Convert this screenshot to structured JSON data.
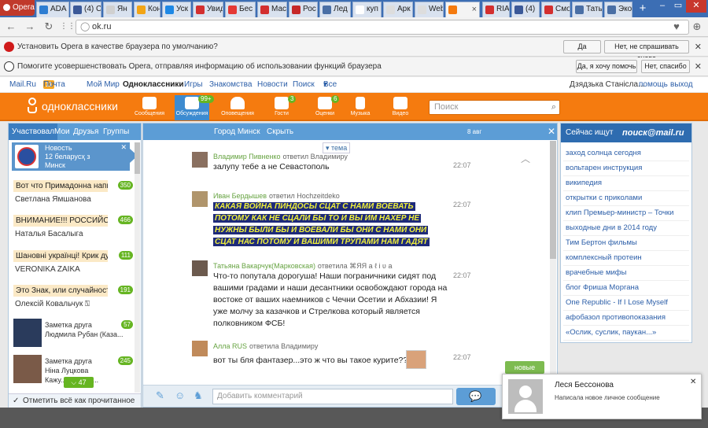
{
  "browser": {
    "opera_label": "Opera",
    "tabs": [
      {
        "label": "ADA",
        "color": "#2d7dd2"
      },
      {
        "label": "(4) С",
        "color": "#3b5998"
      },
      {
        "label": "Ян",
        "color": "#d0d0d0"
      },
      {
        "label": "Кон",
        "color": "#f2a516"
      },
      {
        "label": "Уск",
        "color": "#1e88e5"
      },
      {
        "label": "Увид",
        "color": "#d32f2f"
      },
      {
        "label": "Бес",
        "color": "#e53935"
      },
      {
        "label": "Мас",
        "color": "#d32f2f"
      },
      {
        "label": "Рос",
        "color": "#c62828"
      },
      {
        "label": "Лед",
        "color": "#4a6fa5"
      },
      {
        "label": "куп",
        "color": "#fff"
      },
      {
        "label": "Арк",
        "color": "#ddd"
      },
      {
        "label": "Web",
        "color": "#ddd"
      },
      {
        "label": "",
        "color": "#f57b0f"
      },
      {
        "label": "RIA",
        "color": "#d32f2f"
      },
      {
        "label": "(4) ",
        "color": "#3b5998"
      },
      {
        "label": "Смо",
        "color": "#d32f2f"
      },
      {
        "label": "Татья",
        "color": "#4a6fa5"
      },
      {
        "label": "Эко",
        "color": "#4a6fa5"
      }
    ],
    "url": "ok.ru"
  },
  "infobars": [
    {
      "text": "Установить Opera в качестве браузера по умолчанию?",
      "btn1": "Да",
      "btn2": "Нет, не спрашивать снова"
    },
    {
      "text": "Помогите усовершенствовать Opera, отправляя информацию об использовании функций браузера",
      "btn1": "Да, я хочу помочь",
      "btn2": "Нет, спасибо"
    }
  ],
  "portal": {
    "links": [
      "Mail.Ru",
      "Почта",
      "Мой Мир",
      "Одноклассники",
      "Игры",
      "Знакомства",
      "Новости",
      "Поиск",
      "Все проекты"
    ],
    "mail_count": "11",
    "user": "Дзядзька Станісла...",
    "help": "помощь",
    "exit": "выход"
  },
  "ok": {
    "logo": "одноклассники",
    "nav": [
      {
        "label": "Сообщения",
        "badge": ""
      },
      {
        "label": "Обсуждения",
        "badge": "99+"
      },
      {
        "label": "Оповещения",
        "badge": ""
      },
      {
        "label": "Гости",
        "badge": "3"
      },
      {
        "label": "Оценки",
        "badge": "6"
      },
      {
        "label": "Музыка",
        "badge": ""
      },
      {
        "label": "Видео",
        "badge": ""
      }
    ],
    "search_placeholder": "Поиск"
  },
  "left": {
    "tabs": [
      "Участвовал",
      "Мои",
      "Друзья",
      "Группы"
    ],
    "news": {
      "title": "Новость",
      "line2": "12 беларусҳ з",
      "line3": "Минск"
    },
    "threads": [
      {
        "title": "Вот что Примадонна напи...",
        "count": "350",
        "author": "Светлана Ямшанова"
      },
      {
        "title": "ВНИМАНИЕ!!! РОССИЙСК...",
        "count": "466",
        "author": "Наталья Басалыга"
      },
      {
        "title": "Шановні українці! Крик ду...",
        "count": "111",
        "author": "VERONIKA ZAIKA"
      },
      {
        "title": "Это Знак, или случайность ?",
        "count": "191",
        "author": "Олексій Ковальчук ⍂"
      }
    ],
    "group_threads": [
      {
        "title": "Заметка друга",
        "author": "Людмила Рубан (Каза...",
        "count": "57"
      },
      {
        "title": "Заметка друга",
        "author": "Ніна Луцкова",
        "count": "245",
        "extra": "Кажу... ики мат..."
      }
    ],
    "scroll_count": "47",
    "mark_read": "Отметить всё как прочитанное"
  },
  "chat": {
    "city": "Город Минск",
    "hide": "Скрыть",
    "date": "8 авг",
    "tema": "тема",
    "messages": [
      {
        "name": "Владимир Пивненко",
        "reply": "ответил Владимиру",
        "text": "залупу тебе а не Севастополь",
        "time": "22:07"
      },
      {
        "name": "Иван Бердышев",
        "reply": "ответил Hochzeitdeko",
        "lines": [
          "КАКАЯ ВОЙНА ПИНДОСЫ СЦАТ С НАМИ ВОЕВАТЬ",
          "ПОТОМУ КАК НЕ СЦАЛИ БЫ ТО И ВЫ ИМ НАХЕР НЕ",
          "НУЖНЫ БЫЛИ БЫ И ВОЕВАЛИ БЫ ОНИ С НАМИ ОНИ",
          "СЦАТ НАС ПОТОМУ И ВАШИМИ ТРУПАМИ НАМ ГАДЯТ"
        ],
        "time": "22:07"
      },
      {
        "name": "Татьяна Вакарчук(Марковская)",
        "reply": "ответила ⌘ЯЯ a ℓ i ʋ a",
        "lines": [
          "Что-то попутала дорогуша! Наши пограничники сидят под",
          "вашими градами и наши десантники освобождают города на",
          "востоке от ваших наемников с Чечни Осетии и Абхазии! Я",
          "уже молчу за казачков и Стрелкова который является",
          "полковником ФСБ!"
        ],
        "time": "22:07"
      },
      {
        "name": "Алла RUS",
        "reply": "ответила Владимиру",
        "text": "вот ты бля фантазер...это ж что вы такое курите???",
        "time": "22:07"
      }
    ],
    "new_label": "новые",
    "input_placeholder": "Добавить комментарий"
  },
  "right": {
    "title": "Сейчас ищут",
    "brand": "поиск@mail.ru",
    "queries": [
      "заход солнца сегодня",
      "вольтарен инструкция",
      "википедия",
      "открытки с приколами",
      "клип Премьер-министр – Точки",
      "выходные дни в 2014 году",
      "Тим Бертон фильмы",
      "комплексный протеин",
      "врачебные мифы",
      "блог Фриша Моргана",
      "One Republic - If I Lose Myself",
      "афобазол противопоказания",
      "«Ослик, суслик, паукан...»"
    ]
  },
  "popup": {
    "name": "Леся Бессонова",
    "text": "Написала новое личное сообщение"
  }
}
